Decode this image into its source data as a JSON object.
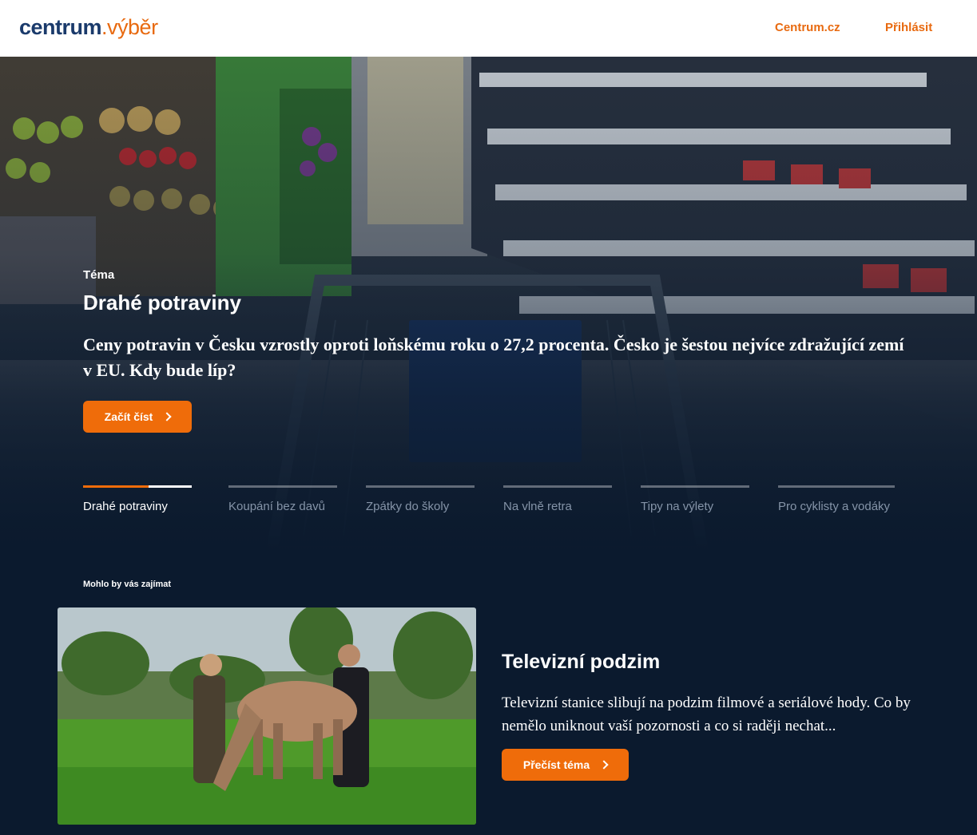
{
  "header": {
    "logo_brand": "centrum",
    "logo_suffix": ".výběr",
    "nav": {
      "centrum": "Centrum.cz",
      "login": "Přihlásit"
    }
  },
  "hero": {
    "kicker": "Téma",
    "title": "Drahé potraviny",
    "description": "Ceny potravin v Česku vzrostly oproti loňskému roku o 27,2 procenta. Česko je šestou nejvíce zdražující zemí v EU. Kdy bude líp?",
    "cta": "Začít číst",
    "image": "supermarket-shopping-cart-photo"
  },
  "tabs": [
    {
      "label": "Drahé potraviny",
      "active": true,
      "progress": 0.6
    },
    {
      "label": "Koupání bez davů",
      "active": false
    },
    {
      "label": "Zpátky do školy",
      "active": false
    },
    {
      "label": "Na vlně retra",
      "active": false
    },
    {
      "label": "Tipy na výlety",
      "active": false
    },
    {
      "label": "Pro cyklisty a vodáky",
      "active": false
    }
  ],
  "recommend": {
    "section_label": "Mohlo by vás zajímat",
    "title": "Televizní podzim",
    "description": "Televizní stanice slibují na podzim filmové a seriálové hody. Co by nemělo uniknout vaší pozornosti a co si raději nechat...",
    "cta": "Přečíst téma",
    "image": "two-women-with-horse-in-meadow-photo"
  },
  "colors": {
    "accent": "#ef6c0a",
    "brand": "#1a3a6b",
    "background": "#0b1a2e"
  }
}
